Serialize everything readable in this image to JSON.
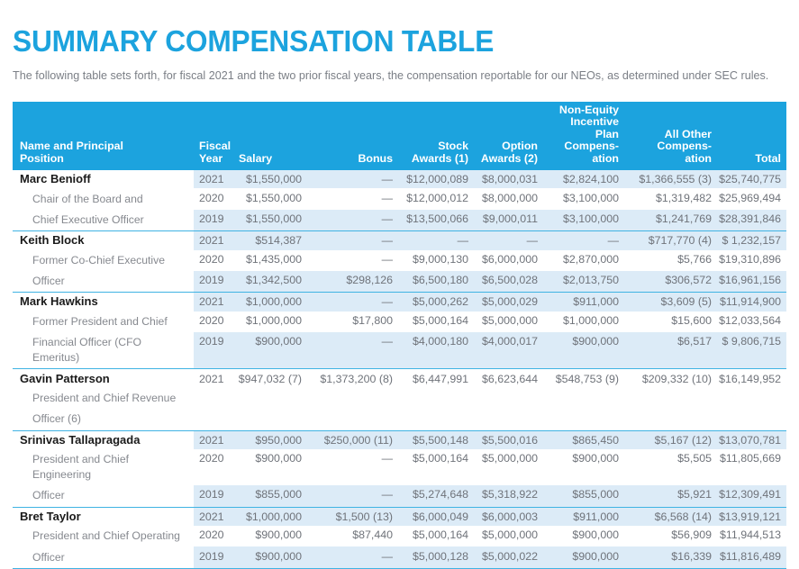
{
  "page_title": "SUMMARY COMPENSATION TABLE",
  "intro": "The following table sets forth, for fiscal 2021 and the two prior fiscal years, the compensation reportable for our NEOs, as determined under SEC rules.",
  "colors": {
    "accent": "#1CA3DE",
    "stripe": "#DCEBF7",
    "rule": "#3FB3E3",
    "body_text": "#6f737a",
    "name_text": "#1a1a1a"
  },
  "table": {
    "headers": {
      "name": "Name and Principal\nPosition",
      "fiscal_year": "Fiscal\nYear",
      "salary": "Salary",
      "bonus": "Bonus",
      "stock_awards": "Stock\nAwards (1)",
      "option_awards": "Option\nAwards (2)",
      "neip": "Non-Equity\nIncentive\nPlan\nCompens-\nation",
      "all_other": "All Other\nCompens-\nation",
      "total": "Total"
    },
    "blocks": [
      {
        "name": "Marc Benioff",
        "title_lines": [
          "Chair of the Board and",
          "Chief Executive Officer"
        ],
        "rows": [
          {
            "year": "2021",
            "salary": "$1,550,000",
            "bonus": "—",
            "stock_awards": "$12,000,089",
            "option_awards": "$8,000,031",
            "neip": "$2,824,100",
            "all_other": "$1,366,555 (3)",
            "total": "$25,740,775"
          },
          {
            "year": "2020",
            "salary": "$1,550,000",
            "bonus": "—",
            "stock_awards": "$12,000,012",
            "option_awards": "$8,000,000",
            "neip": "$3,100,000",
            "all_other": "$1,319,482",
            "total": "$25,969,494"
          },
          {
            "year": "2019",
            "salary": "$1,550,000",
            "bonus": "—",
            "stock_awards": "$13,500,066",
            "option_awards": "$9,000,011",
            "neip": "$3,100,000",
            "all_other": "$1,241,769",
            "total": "$28,391,846"
          }
        ]
      },
      {
        "name": "Keith Block",
        "title_lines": [
          "Former Co-Chief Executive",
          "Officer"
        ],
        "rows": [
          {
            "year": "2021",
            "salary": "$514,387",
            "bonus": "—",
            "stock_awards": "—",
            "option_awards": "—",
            "neip": "—",
            "all_other": "$717,770 (4)",
            "total": "$ 1,232,157"
          },
          {
            "year": "2020",
            "salary": "$1,435,000",
            "bonus": "—",
            "stock_awards": "$9,000,130",
            "option_awards": "$6,000,000",
            "neip": "$2,870,000",
            "all_other": "$5,766",
            "total": "$19,310,896"
          },
          {
            "year": "2019",
            "salary": "$1,342,500",
            "bonus": "$298,126",
            "stock_awards": "$6,500,180",
            "option_awards": "$6,500,028",
            "neip": "$2,013,750",
            "all_other": "$306,572",
            "total": "$16,961,156"
          }
        ]
      },
      {
        "name": "Mark Hawkins",
        "title_lines": [
          "Former President and Chief",
          "Financial Officer (CFO Emeritus)"
        ],
        "rows": [
          {
            "year": "2021",
            "salary": "$1,000,000",
            "bonus": "—",
            "stock_awards": "$5,000,262",
            "option_awards": "$5,000,029",
            "neip": "$911,000",
            "all_other": "$3,609 (5)",
            "total": "$11,914,900"
          },
          {
            "year": "2020",
            "salary": "$1,000,000",
            "bonus": "$17,800",
            "stock_awards": "$5,000,164",
            "option_awards": "$5,000,000",
            "neip": "$1,000,000",
            "all_other": "$15,600",
            "total": "$12,033,564"
          },
          {
            "year": "2019",
            "salary": "$900,000",
            "bonus": "—",
            "stock_awards": "$4,000,180",
            "option_awards": "$4,000,017",
            "neip": "$900,000",
            "all_other": "$6,517",
            "total": "$ 9,806,715"
          }
        ]
      },
      {
        "name": "Gavin Patterson",
        "title_lines": [
          "President and Chief Revenue",
          "Officer (6)"
        ],
        "all_plain": true,
        "rows": [
          {
            "year": "2021",
            "salary": "$947,032 (7)",
            "bonus": "$1,373,200 (8)",
            "stock_awards": "$6,447,991",
            "option_awards": "$6,623,644",
            "neip": "$548,753 (9)",
            "all_other": "$209,332 (10)",
            "total": "$16,149,952"
          },
          {
            "year": "",
            "salary": "",
            "bonus": "",
            "stock_awards": "",
            "option_awards": "",
            "neip": "",
            "all_other": "",
            "total": ""
          },
          {
            "year": "",
            "salary": "",
            "bonus": "",
            "stock_awards": "",
            "option_awards": "",
            "neip": "",
            "all_other": "",
            "total": ""
          }
        ]
      },
      {
        "name": "Srinivas Tallapragada",
        "title_lines": [
          "President and Chief Engineering",
          "Officer"
        ],
        "rows": [
          {
            "year": "2021",
            "salary": "$950,000",
            "bonus": "$250,000 (11)",
            "stock_awards": "$5,500,148",
            "option_awards": "$5,500,016",
            "neip": "$865,450",
            "all_other": "$5,167 (12)",
            "total": "$13,070,781"
          },
          {
            "year": "2020",
            "salary": "$900,000",
            "bonus": "—",
            "stock_awards": "$5,000,164",
            "option_awards": "$5,000,000",
            "neip": "$900,000",
            "all_other": "$5,505",
            "total": "$11,805,669"
          },
          {
            "year": "2019",
            "salary": "$855,000",
            "bonus": "—",
            "stock_awards": "$5,274,648",
            "option_awards": "$5,318,922",
            "neip": "$855,000",
            "all_other": "$5,921",
            "total": "$12,309,491"
          }
        ]
      },
      {
        "name": "Bret Taylor",
        "title_lines": [
          "President and Chief Operating",
          "Officer"
        ],
        "rows": [
          {
            "year": "2021",
            "salary": "$1,000,000",
            "bonus": "$1,500 (13)",
            "stock_awards": "$6,000,049",
            "option_awards": "$6,000,003",
            "neip": "$911,000",
            "all_other": "$6,568 (14)",
            "total": "$13,919,121"
          },
          {
            "year": "2020",
            "salary": "$900,000",
            "bonus": "$87,440",
            "stock_awards": "$5,000,164",
            "option_awards": "$5,000,000",
            "neip": "$900,000",
            "all_other": "$56,909",
            "total": "$11,944,513"
          },
          {
            "year": "2019",
            "salary": "$900,000",
            "bonus": "—",
            "stock_awards": "$5,000,128",
            "option_awards": "$5,000,022",
            "neip": "$900,000",
            "all_other": "$16,339",
            "total": "$11,816,489"
          }
        ]
      }
    ]
  }
}
